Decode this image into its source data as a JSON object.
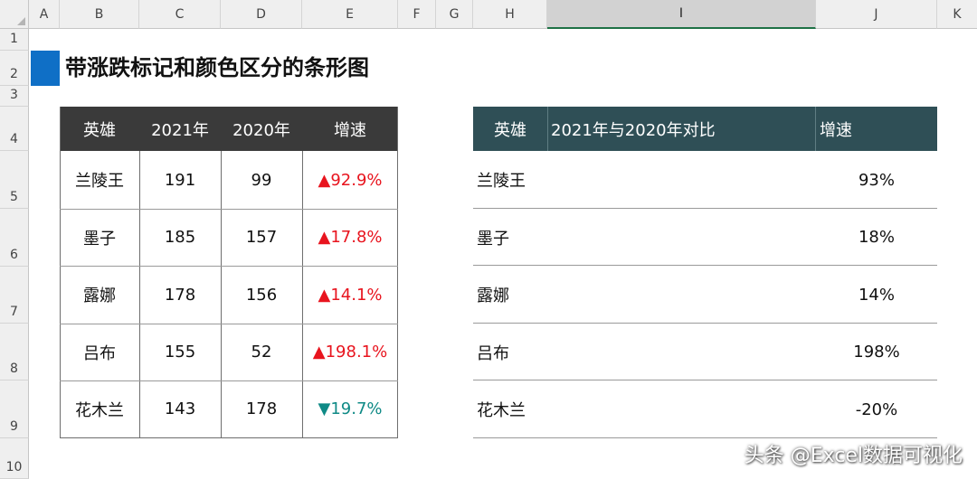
{
  "sheet": {
    "columns": [
      "A",
      "B",
      "C",
      "D",
      "E",
      "F",
      "G",
      "H",
      "I",
      "J",
      "K"
    ],
    "rows": [
      "1",
      "2",
      "3",
      "4",
      "5",
      "6",
      "7",
      "8",
      "9",
      "10"
    ],
    "selected_column": "I"
  },
  "title": "带涨跌标记和颜色区分的条形图",
  "left_table": {
    "headers": [
      "英雄",
      "2021年",
      "2020年",
      "增速"
    ],
    "rows": [
      {
        "hero": "兰陵王",
        "y2021": "191",
        "y2020": "99",
        "growth": "▲92.9%",
        "direction": "up"
      },
      {
        "hero": "墨子",
        "y2021": "185",
        "y2020": "157",
        "growth": "▲17.8%",
        "direction": "up"
      },
      {
        "hero": "露娜",
        "y2021": "178",
        "y2020": "156",
        "growth": "▲14.1%",
        "direction": "up"
      },
      {
        "hero": "吕布",
        "y2021": "155",
        "y2020": "52",
        "growth": "▲198.1%",
        "direction": "up"
      },
      {
        "hero": "花木兰",
        "y2021": "143",
        "y2020": "178",
        "growth": "▼19.7%",
        "direction": "down"
      }
    ]
  },
  "right_table": {
    "headers": [
      "英雄",
      "2021年与2020年对比",
      "增速"
    ],
    "rows": [
      {
        "hero": "兰陵王",
        "growth": "93%"
      },
      {
        "hero": "墨子",
        "growth": "18%"
      },
      {
        "hero": "露娜",
        "growth": "14%"
      },
      {
        "hero": "吕布",
        "growth": "198%"
      },
      {
        "hero": "花木兰",
        "growth": "-20%"
      }
    ]
  },
  "watermark": "头条 @Excel数据可视化",
  "colors": {
    "up": "#e8141e",
    "down": "#0f8a86",
    "left_header": "#3a3a3a",
    "right_header": "#2f4f56",
    "title_accent": "#0f6fc6"
  }
}
